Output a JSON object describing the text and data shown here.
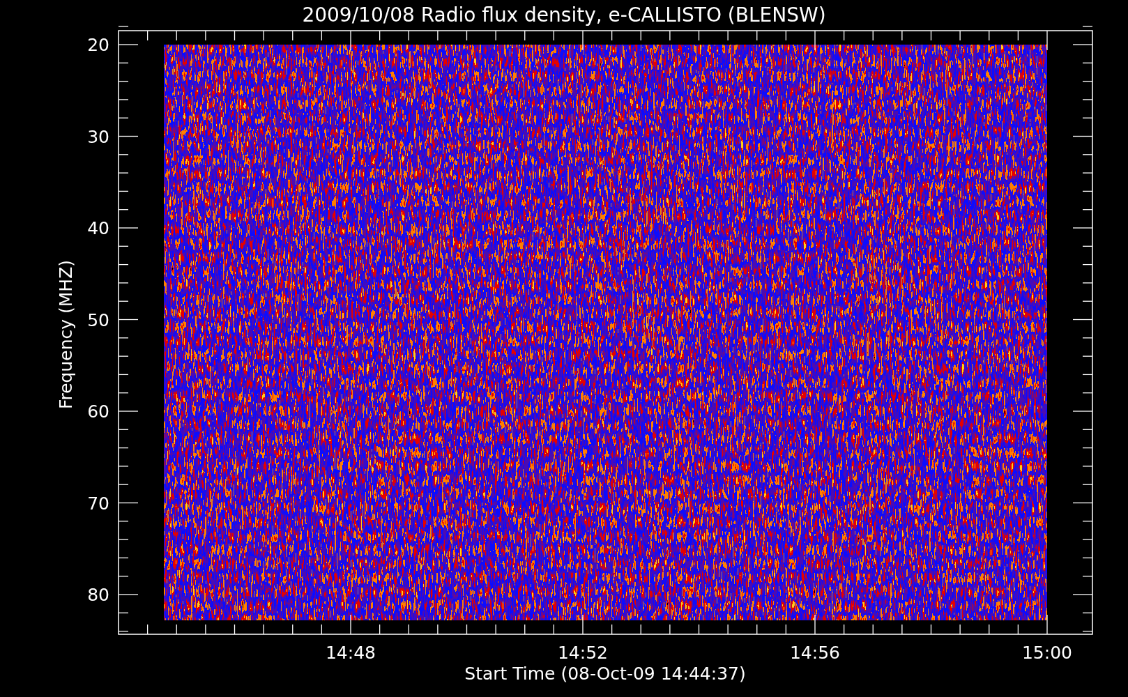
{
  "plot": {
    "title": "2009/10/08  Radio flux density, e-CALLISTO (BLENSW)",
    "ylabel": "Frequency (MHZ)",
    "xlabel": "Start Time (08-Oct-09 14:44:37)",
    "yticks": [
      "20",
      "30",
      "40",
      "50",
      "60",
      "70",
      "80"
    ],
    "xticks": [
      "14:48",
      "14:52",
      "14:56",
      "15:00"
    ]
  }
}
